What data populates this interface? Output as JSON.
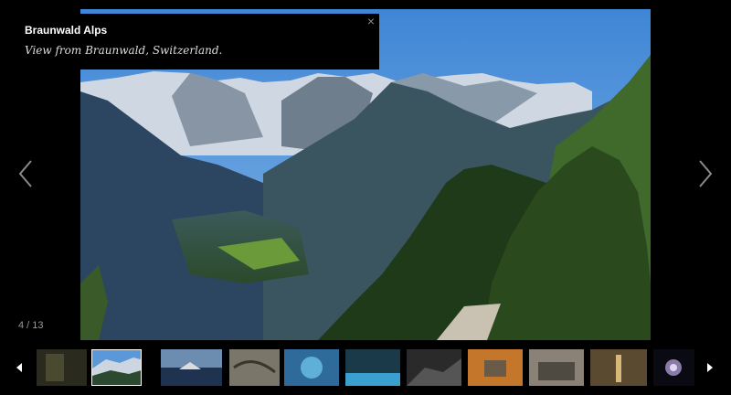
{
  "caption": {
    "title": "Braunwald Alps",
    "description": "View from Braunwald, Switzerland."
  },
  "counter": "4 / 13",
  "close_label": "×",
  "colors": {
    "background": "#000000",
    "caption_bg": "#000000",
    "active_thumb_border": "#ffffff",
    "arrow": "#8a8a8a"
  },
  "thumbnails": [
    {
      "name": "thumb-dark-forest",
      "active": false
    },
    {
      "name": "thumb-braunwald-alps",
      "active": true
    },
    {
      "name": "thumb-sea-iceberg",
      "active": false
    },
    {
      "name": "thumb-grey-rock",
      "active": false
    },
    {
      "name": "thumb-blue-lagoon",
      "active": false
    },
    {
      "name": "thumb-cave-water",
      "active": false
    },
    {
      "name": "thumb-dark-rock",
      "active": false
    },
    {
      "name": "thumb-orange-van",
      "active": false
    },
    {
      "name": "thumb-ruins",
      "active": false
    },
    {
      "name": "thumb-interior",
      "active": false
    },
    {
      "name": "thumb-galaxy",
      "active": false
    }
  ]
}
